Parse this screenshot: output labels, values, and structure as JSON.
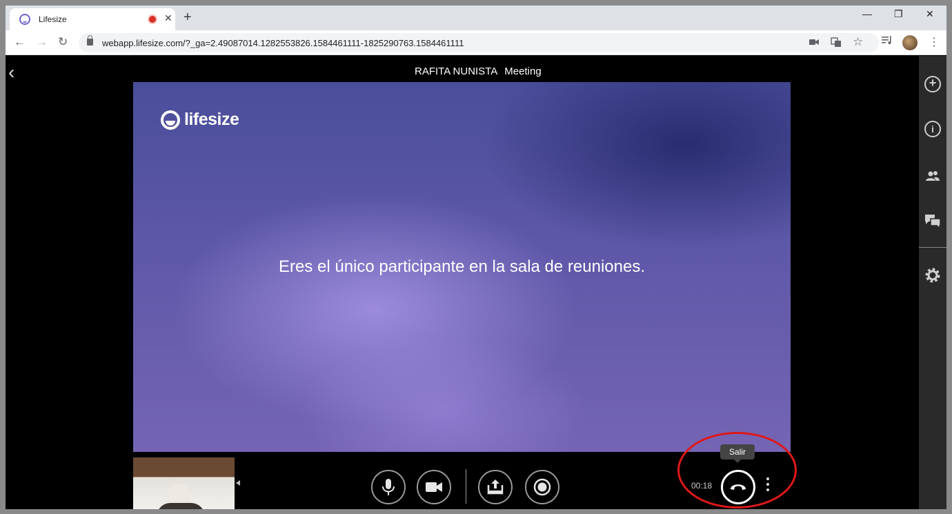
{
  "browser": {
    "tab_title": "Lifesize",
    "tab_close": "✕",
    "new_tab": "+",
    "url": "webapp.lifesize.com/?_ga=2.49087014.1282553826.1584461111-1825290763.1584461111"
  },
  "meeting": {
    "host": "RAFITA NUNISTA",
    "label": "Meeting"
  },
  "stage": {
    "logo_text": "lifesize",
    "message": "Eres el único participante en la sala de reuniones."
  },
  "call": {
    "timer": "00:18",
    "hangup_tooltip": "Salir"
  },
  "icons": {
    "sidebar": [
      "add-circle-icon",
      "info-icon",
      "participants-icon",
      "chat-icon",
      "settings-gear-icon"
    ],
    "controls": [
      "microphone-icon",
      "camera-icon",
      "share-screen-icon",
      "record-icon",
      "hangup-phone-icon",
      "more-vertical-icon"
    ]
  },
  "colors": {
    "annotation_ellipse": "#e01818",
    "recording_dot": "#d93025",
    "sidebar_bg": "#2a2a2a"
  }
}
